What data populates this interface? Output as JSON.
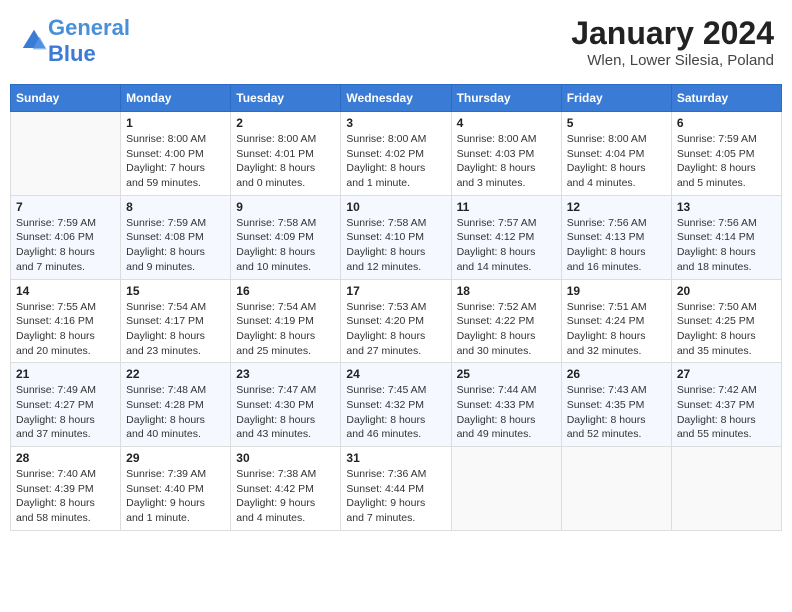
{
  "header": {
    "logo_text_general": "General",
    "logo_text_blue": "Blue",
    "month": "January 2024",
    "location": "Wlen, Lower Silesia, Poland"
  },
  "weekdays": [
    "Sunday",
    "Monday",
    "Tuesday",
    "Wednesday",
    "Thursday",
    "Friday",
    "Saturday"
  ],
  "weeks": [
    [
      {
        "day": "",
        "info": ""
      },
      {
        "day": "1",
        "info": "Sunrise: 8:00 AM\nSunset: 4:00 PM\nDaylight: 7 hours\nand 59 minutes."
      },
      {
        "day": "2",
        "info": "Sunrise: 8:00 AM\nSunset: 4:01 PM\nDaylight: 8 hours\nand 0 minutes."
      },
      {
        "day": "3",
        "info": "Sunrise: 8:00 AM\nSunset: 4:02 PM\nDaylight: 8 hours\nand 1 minute."
      },
      {
        "day": "4",
        "info": "Sunrise: 8:00 AM\nSunset: 4:03 PM\nDaylight: 8 hours\nand 3 minutes."
      },
      {
        "day": "5",
        "info": "Sunrise: 8:00 AM\nSunset: 4:04 PM\nDaylight: 8 hours\nand 4 minutes."
      },
      {
        "day": "6",
        "info": "Sunrise: 7:59 AM\nSunset: 4:05 PM\nDaylight: 8 hours\nand 5 minutes."
      }
    ],
    [
      {
        "day": "7",
        "info": "Sunrise: 7:59 AM\nSunset: 4:06 PM\nDaylight: 8 hours\nand 7 minutes."
      },
      {
        "day": "8",
        "info": "Sunrise: 7:59 AM\nSunset: 4:08 PM\nDaylight: 8 hours\nand 9 minutes."
      },
      {
        "day": "9",
        "info": "Sunrise: 7:58 AM\nSunset: 4:09 PM\nDaylight: 8 hours\nand 10 minutes."
      },
      {
        "day": "10",
        "info": "Sunrise: 7:58 AM\nSunset: 4:10 PM\nDaylight: 8 hours\nand 12 minutes."
      },
      {
        "day": "11",
        "info": "Sunrise: 7:57 AM\nSunset: 4:12 PM\nDaylight: 8 hours\nand 14 minutes."
      },
      {
        "day": "12",
        "info": "Sunrise: 7:56 AM\nSunset: 4:13 PM\nDaylight: 8 hours\nand 16 minutes."
      },
      {
        "day": "13",
        "info": "Sunrise: 7:56 AM\nSunset: 4:14 PM\nDaylight: 8 hours\nand 18 minutes."
      }
    ],
    [
      {
        "day": "14",
        "info": "Sunrise: 7:55 AM\nSunset: 4:16 PM\nDaylight: 8 hours\nand 20 minutes."
      },
      {
        "day": "15",
        "info": "Sunrise: 7:54 AM\nSunset: 4:17 PM\nDaylight: 8 hours\nand 23 minutes."
      },
      {
        "day": "16",
        "info": "Sunrise: 7:54 AM\nSunset: 4:19 PM\nDaylight: 8 hours\nand 25 minutes."
      },
      {
        "day": "17",
        "info": "Sunrise: 7:53 AM\nSunset: 4:20 PM\nDaylight: 8 hours\nand 27 minutes."
      },
      {
        "day": "18",
        "info": "Sunrise: 7:52 AM\nSunset: 4:22 PM\nDaylight: 8 hours\nand 30 minutes."
      },
      {
        "day": "19",
        "info": "Sunrise: 7:51 AM\nSunset: 4:24 PM\nDaylight: 8 hours\nand 32 minutes."
      },
      {
        "day": "20",
        "info": "Sunrise: 7:50 AM\nSunset: 4:25 PM\nDaylight: 8 hours\nand 35 minutes."
      }
    ],
    [
      {
        "day": "21",
        "info": "Sunrise: 7:49 AM\nSunset: 4:27 PM\nDaylight: 8 hours\nand 37 minutes."
      },
      {
        "day": "22",
        "info": "Sunrise: 7:48 AM\nSunset: 4:28 PM\nDaylight: 8 hours\nand 40 minutes."
      },
      {
        "day": "23",
        "info": "Sunrise: 7:47 AM\nSunset: 4:30 PM\nDaylight: 8 hours\nand 43 minutes."
      },
      {
        "day": "24",
        "info": "Sunrise: 7:45 AM\nSunset: 4:32 PM\nDaylight: 8 hours\nand 46 minutes."
      },
      {
        "day": "25",
        "info": "Sunrise: 7:44 AM\nSunset: 4:33 PM\nDaylight: 8 hours\nand 49 minutes."
      },
      {
        "day": "26",
        "info": "Sunrise: 7:43 AM\nSunset: 4:35 PM\nDaylight: 8 hours\nand 52 minutes."
      },
      {
        "day": "27",
        "info": "Sunrise: 7:42 AM\nSunset: 4:37 PM\nDaylight: 8 hours\nand 55 minutes."
      }
    ],
    [
      {
        "day": "28",
        "info": "Sunrise: 7:40 AM\nSunset: 4:39 PM\nDaylight: 8 hours\nand 58 minutes."
      },
      {
        "day": "29",
        "info": "Sunrise: 7:39 AM\nSunset: 4:40 PM\nDaylight: 9 hours\nand 1 minute."
      },
      {
        "day": "30",
        "info": "Sunrise: 7:38 AM\nSunset: 4:42 PM\nDaylight: 9 hours\nand 4 minutes."
      },
      {
        "day": "31",
        "info": "Sunrise: 7:36 AM\nSunset: 4:44 PM\nDaylight: 9 hours\nand 7 minutes."
      },
      {
        "day": "",
        "info": ""
      },
      {
        "day": "",
        "info": ""
      },
      {
        "day": "",
        "info": ""
      }
    ]
  ]
}
